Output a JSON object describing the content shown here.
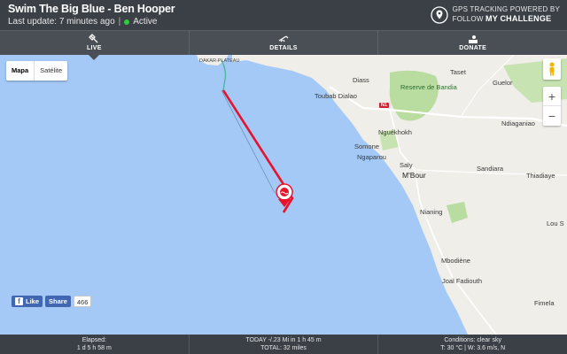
{
  "header": {
    "title": "Swim The Big Blue - Ben Hooper",
    "last_update": "Last update: 7 minutes ago",
    "separator": "|",
    "status": "Active",
    "status_color": "#2ecc40",
    "brand_line1": "GPS TRACKING POWERED BY",
    "brand_line2_a": "FOLLOW",
    "brand_line2_b": "MY CHALLENGE",
    "brand_icon": "map-pin-icon"
  },
  "nav": {
    "tabs": [
      {
        "label": "LIVE",
        "icon": "satellite-icon",
        "active": true
      },
      {
        "label": "DETAILS",
        "icon": "telescope-icon",
        "active": false
      },
      {
        "label": "DONATE",
        "icon": "donate-hand-icon",
        "active": false
      }
    ]
  },
  "map": {
    "map_type": {
      "map": "Mapa",
      "satellite": "Satélite",
      "selected": "Mapa"
    },
    "zoom_in": "+",
    "zoom_out": "−",
    "route_color": "#e8132b",
    "ocean_color": "#a4c9f7",
    "land_color": "#f0eee9",
    "park_color": "#b9dca0",
    "places": [
      "DAKAR-PLATEAU",
      "Diass",
      "Toubab Dialao",
      "Reserve de Bandia",
      "Taset",
      "Guelor",
      "Nguékhokh",
      "Ndiaganiao",
      "Somone",
      "Ngaparou",
      "Saly",
      "M'Bour",
      "Sandiara",
      "Thiadiaye",
      "Nianing",
      "Mbodiène",
      "Joal Fadiouth",
      "Fimela",
      "Lou S"
    ],
    "road_shield": "N1"
  },
  "social": {
    "like": "Like",
    "share": "Share",
    "count": "466"
  },
  "footer": {
    "elapsed_label": "Elapsed:",
    "elapsed_value": "1 d 5 h 58 m",
    "today": "TODAY -/.23 Mi in 1 h 45 m",
    "total": "TOTAL: 32 miles",
    "conditions": "Conditions: clear sky",
    "weather": "T: 30 °C | W: 3.6 m/s, N"
  }
}
